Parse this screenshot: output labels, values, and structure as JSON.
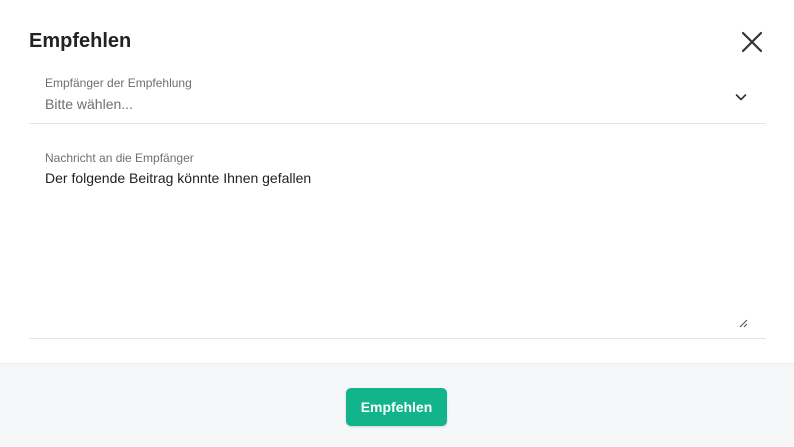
{
  "dialog": {
    "title": "Empfehlen",
    "close_icon": "close-icon"
  },
  "recipients": {
    "label": "Empfänger der Empfehlung",
    "placeholder": "Bitte wählen...",
    "icon": "chevron-down-icon"
  },
  "message": {
    "label": "Nachricht an die Empfänger",
    "value": "Der folgende Beitrag könnte Ihnen gefallen"
  },
  "footer": {
    "submit_label": "Empfehlen"
  },
  "colors": {
    "accent": "#12b48b",
    "footer_bg": "#f6f7f9",
    "label_gray": "#6f6f6f",
    "text_dark": "#222222"
  }
}
